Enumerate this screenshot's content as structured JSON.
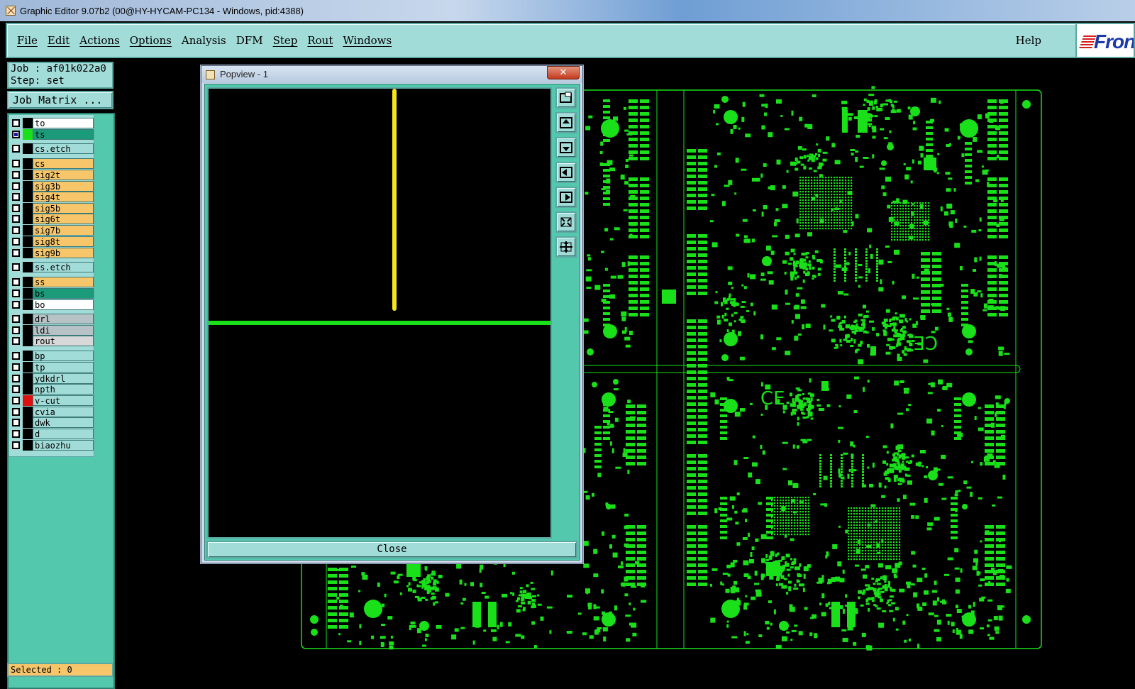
{
  "window": {
    "title": "Graphic Editor 9.07b2 (00@HY-HYCAM-PC134 - Windows, pid:4388)"
  },
  "menu": {
    "items": [
      "File",
      "Edit",
      "Actions",
      "Options",
      "Analysis",
      "DFM",
      "Step",
      "Rout",
      "Windows"
    ],
    "help": "Help",
    "brand": "Fron"
  },
  "job": {
    "job_label": "Job : af01k022a0",
    "step_label": "Step: set",
    "matrix_button": "Job Matrix ..."
  },
  "layers": [
    {
      "name": "to",
      "color": "#ffffff",
      "swatch": "#000000",
      "checked": false
    },
    {
      "name": "ts",
      "color": "#1b9b7a",
      "swatch": "#19e019",
      "checked": true
    },
    {
      "name": "cs.etch",
      "color": "#a2dcd8",
      "swatch": "#000000",
      "checked": false
    },
    {
      "name": "cs",
      "color": "#f7c56a",
      "swatch": "#000000",
      "checked": false
    },
    {
      "name": "sig2t",
      "color": "#f7c56a",
      "swatch": "#000000",
      "checked": false
    },
    {
      "name": "sig3b",
      "color": "#f7c56a",
      "swatch": "#000000",
      "checked": false
    },
    {
      "name": "sig4t",
      "color": "#f7c56a",
      "swatch": "#000000",
      "checked": false
    },
    {
      "name": "sig5b",
      "color": "#f7c56a",
      "swatch": "#000000",
      "checked": false
    },
    {
      "name": "sig6t",
      "color": "#f7c56a",
      "swatch": "#000000",
      "checked": false
    },
    {
      "name": "sig7b",
      "color": "#f7c56a",
      "swatch": "#000000",
      "checked": false
    },
    {
      "name": "sig8t",
      "color": "#f7c56a",
      "swatch": "#000000",
      "checked": false
    },
    {
      "name": "sig9b",
      "color": "#f7c56a",
      "swatch": "#000000",
      "checked": false
    },
    {
      "name": "ss.etch",
      "color": "#a2dcd8",
      "swatch": "#000000",
      "checked": false
    },
    {
      "name": "ss",
      "color": "#f7c56a",
      "swatch": "#000000",
      "checked": false
    },
    {
      "name": "bs",
      "color": "#1b9b7a",
      "swatch": "#000000",
      "checked": false
    },
    {
      "name": "bo",
      "color": "#ffffff",
      "swatch": "#000000",
      "checked": false
    },
    {
      "name": "drl",
      "color": "#b7c2c6",
      "swatch": "#000000",
      "checked": false
    },
    {
      "name": "ldi",
      "color": "#b7c2c6",
      "swatch": "#000000",
      "checked": false
    },
    {
      "name": "rout",
      "color": "#d8d8d8",
      "swatch": "#000000",
      "checked": false
    },
    {
      "name": "bp",
      "color": "#a2dcd8",
      "swatch": "#000000",
      "checked": false
    },
    {
      "name": "tp",
      "color": "#a2dcd8",
      "swatch": "#000000",
      "checked": false
    },
    {
      "name": "ydkdrl",
      "color": "#a2dcd8",
      "swatch": "#000000",
      "checked": false
    },
    {
      "name": "npth",
      "color": "#a2dcd8",
      "swatch": "#000000",
      "checked": false
    },
    {
      "name": "v-cut",
      "color": "#a2dcd8",
      "swatch": "#e01010",
      "checked": false
    },
    {
      "name": "cvia",
      "color": "#a2dcd8",
      "swatch": "#000000",
      "checked": false
    },
    {
      "name": "dwk",
      "color": "#a2dcd8",
      "swatch": "#000000",
      "checked": false
    },
    {
      "name": "d",
      "color": "#a2dcd8",
      "swatch": "#000000",
      "checked": false
    },
    {
      "name": "biaozhu",
      "color": "#a2dcd8",
      "swatch": "#000000",
      "checked": false
    }
  ],
  "status": {
    "selected": "Selected : 0"
  },
  "popview": {
    "title": "Popview - 1",
    "close_glyph": "✕",
    "close_button": "Close"
  },
  "colors": {
    "pcb_green": "#19e019",
    "accent_teal": "#a2dcd8",
    "popview_line": "#f5e617"
  }
}
